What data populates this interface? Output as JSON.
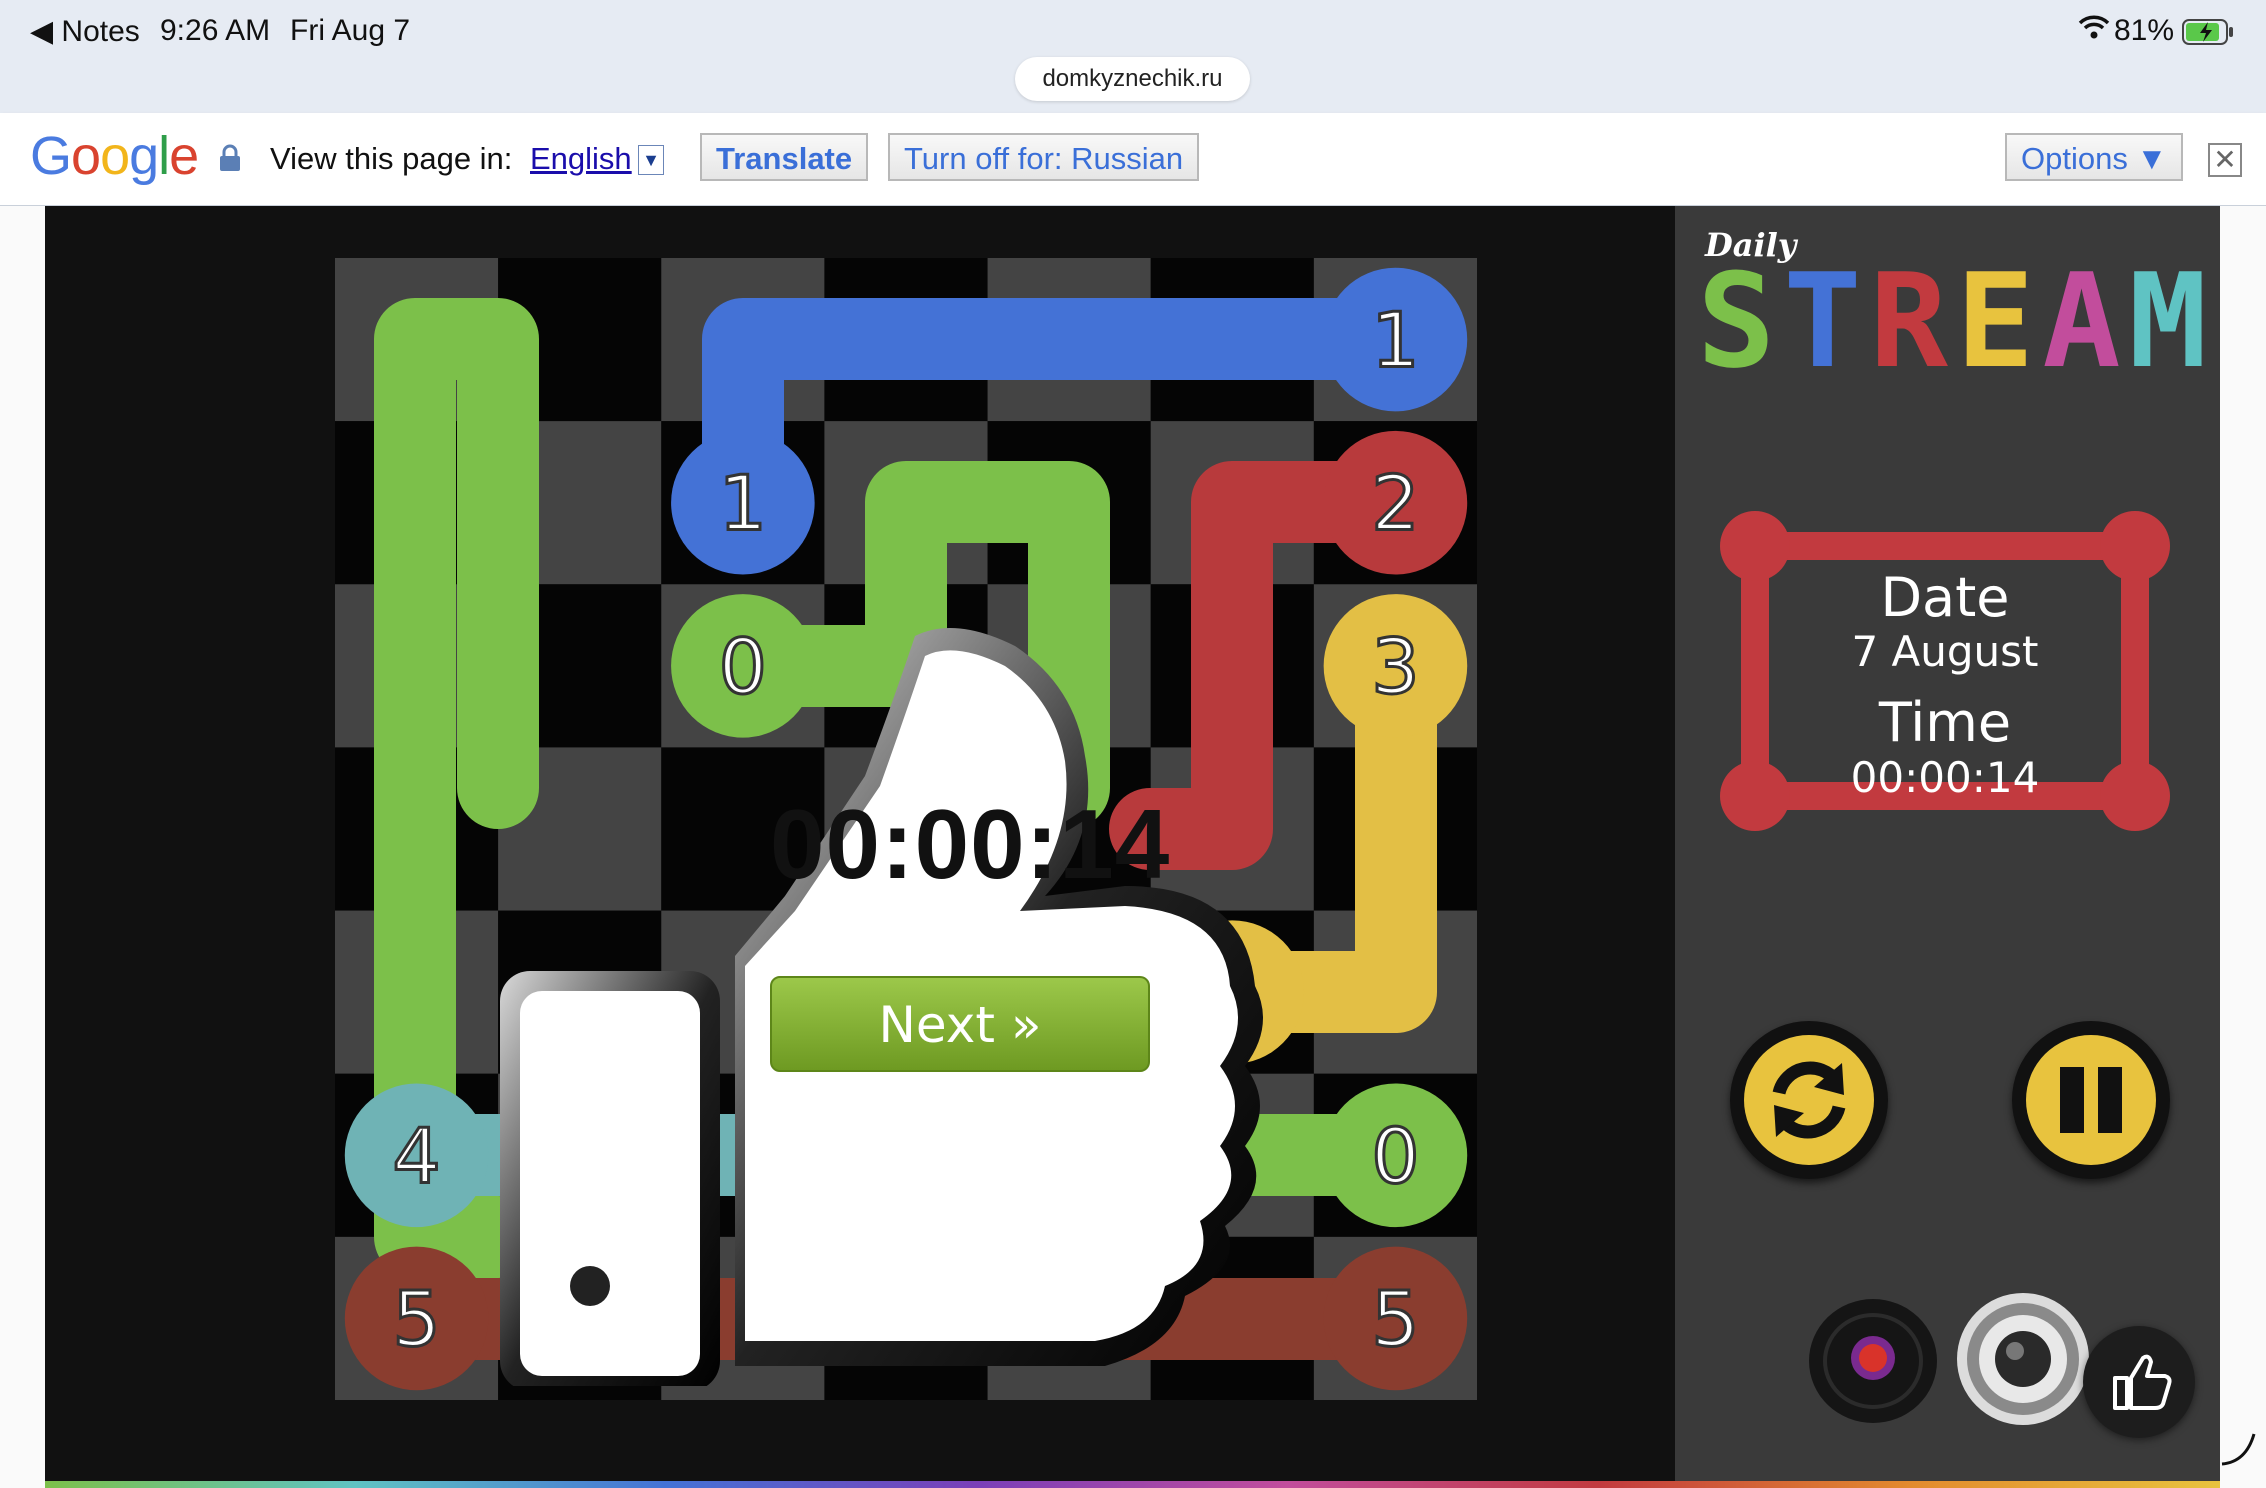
{
  "status_bar": {
    "back_app": "Notes",
    "time": "9:26 AM",
    "date": "Fri Aug 7",
    "battery": "81%",
    "url": "domkyznechik.ru"
  },
  "translate_bar": {
    "brand": "Google",
    "prompt": "View this page in:",
    "language": "English",
    "translate_label": "Translate",
    "turn_off_label": "Turn off for: Russian",
    "options_label": "Options ▼",
    "close_icon": "close-icon"
  },
  "game": {
    "logo_small": "Daily",
    "logo_letters": [
      "S",
      "T",
      "R",
      "E",
      "A",
      "M"
    ],
    "logo_colors": [
      "#7cc04a",
      "#4472d6",
      "#c23a3f",
      "#e8c33e",
      "#c24d9c",
      "#5fc3c3"
    ],
    "date_label": "Date",
    "date_value": "7 August",
    "time_label": "Time",
    "time_value": "00:00:14",
    "completion_time": "00:00:14",
    "next_label": "Next »",
    "board": {
      "size": 7,
      "endpoints": [
        {
          "label": "1",
          "color": "#4472d6",
          "cells": [
            [
              0,
              6
            ],
            [
              1,
              2
            ]
          ]
        },
        {
          "label": "2",
          "color": "#b83a3c",
          "cells": [
            [
              1,
              6
            ]
          ]
        },
        {
          "label": "3",
          "color": "#e3bf45",
          "cells": [
            [
              2,
              6
            ],
            [
              4,
              5
            ]
          ]
        },
        {
          "label": "0",
          "color": "#7cc04a",
          "cells": [
            [
              2,
              2
            ],
            [
              5,
              6
            ]
          ]
        },
        {
          "label": "4",
          "color": "#6fb3b5",
          "cells": [
            [
              5,
              0
            ],
            [
              5,
              3
            ]
          ]
        },
        {
          "label": "5",
          "color": "#8a3d2f",
          "cells": [
            [
              6,
              0
            ],
            [
              6,
              6
            ]
          ]
        }
      ]
    },
    "controls": {
      "restart_icon": "restart-icon",
      "pause_icon": "pause-icon",
      "music_icon": "record-icon",
      "sound_icon": "speaker-icon",
      "like_icon": "thumbs-up-icon"
    }
  }
}
